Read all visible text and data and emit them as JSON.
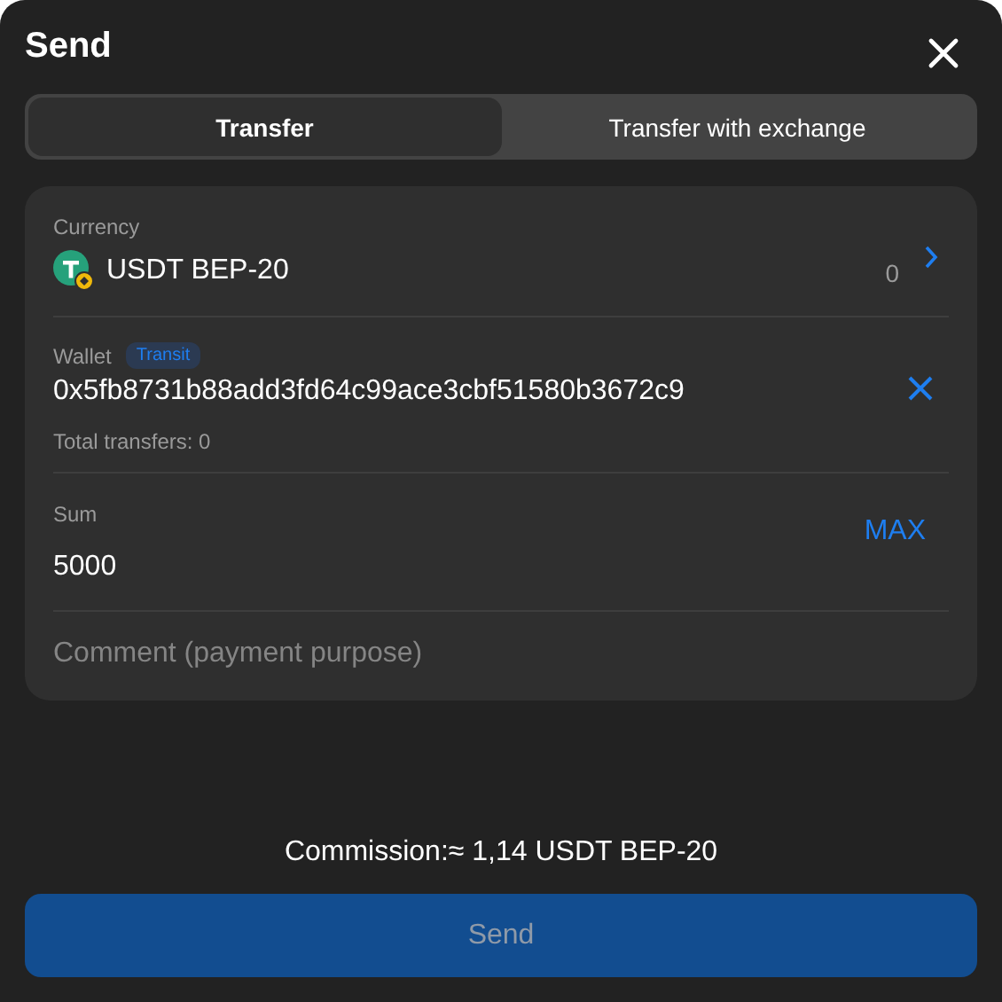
{
  "dialog": {
    "title": "Send"
  },
  "tabs": [
    {
      "label": "Transfer",
      "selected": true
    },
    {
      "label": "Transfer with exchange",
      "selected": false
    }
  ],
  "currency": {
    "label": "Currency",
    "value": "USDT BEP-20",
    "balance": "0"
  },
  "wallet": {
    "label": "Wallet",
    "badge": "Transit",
    "value": "0x5fb8731b88add3fd64c99ace3cbf51580b3672c9",
    "note": "Total transfers: 0"
  },
  "sum": {
    "label": "Sum",
    "value": "5000",
    "max": "MAX"
  },
  "comment": {
    "placeholder": "Comment (payment purpose)"
  },
  "commission": "Commission:≈ 1,14 USDT BEP-20",
  "send_button": {
    "label": "Send",
    "disabled": true
  }
}
